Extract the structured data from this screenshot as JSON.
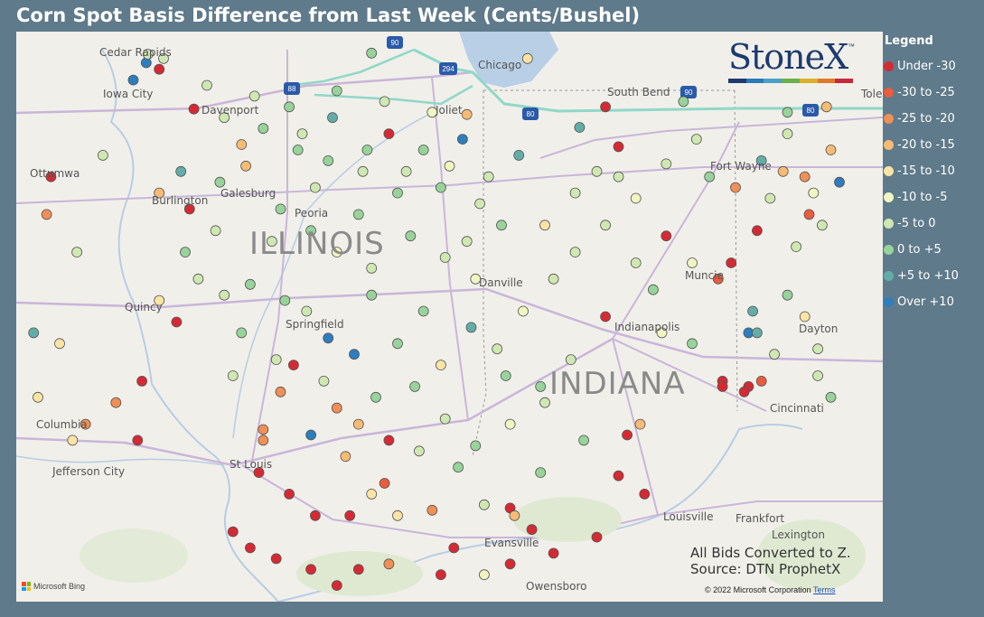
{
  "title": "Corn Spot Basis Difference from Last Week (Cents/Bushel)",
  "logo": {
    "text": "StoneX",
    "tm": "™",
    "bar_colors": [
      "#1d3b6f",
      "#2a7ab8",
      "#4aa0c9",
      "#6ab04c",
      "#d9b02a",
      "#e07a2b",
      "#c8283c"
    ]
  },
  "legend": {
    "title": "Legend",
    "items": [
      {
        "label": "Under -30",
        "color": "#d52a34"
      },
      {
        "label": "-30 to -25",
        "color": "#e95c3e"
      },
      {
        "label": "-25 to -20",
        "color": "#f08f56"
      },
      {
        "label": "-20 to -15",
        "color": "#f7bb74"
      },
      {
        "label": "-15 to -10",
        "color": "#fbe4a4"
      },
      {
        "label": "-10 to -5",
        "color": "#f1f5c2"
      },
      {
        "label": "-5 to 0",
        "color": "#cfe8b2"
      },
      {
        "label": "0 to +5",
        "color": "#97d39a"
      },
      {
        "label": "+5 to +10",
        "color": "#63ada9"
      },
      {
        "label": "Over +10",
        "color": "#2e7dbe"
      }
    ]
  },
  "map": {
    "states": [
      "ILLINOIS",
      "INDIANA"
    ],
    "cities": [
      "Cedar Rapids",
      "Iowa City",
      "Davenport",
      "Ottumwa",
      "Burlington",
      "Galesburg",
      "Peoria",
      "Quincy",
      "Springfield",
      "Columbia",
      "Jefferson City",
      "St Louis",
      "Chicago",
      "Joliet",
      "South Bend",
      "Toledo",
      "Fort Wayne",
      "Danville",
      "Muncie",
      "Indianapolis",
      "Dayton",
      "Cincinnati",
      "Louisville",
      "Frankfort",
      "Lexington",
      "Evansville",
      "Owensboro"
    ],
    "highways": [
      "90",
      "294",
      "88",
      "80",
      "90",
      "80"
    ],
    "notes": [
      "All Bids Converted to Z.",
      "Source: DTN ProphetX"
    ],
    "attribution": "Microsoft Bing",
    "copyright": "© 2022 Microsoft Corporation",
    "terms": "Terms"
  },
  "points": [
    {
      "lon": -91.5,
      "lat": 42.06,
      "cat": 9
    },
    {
      "lon": -91.48,
      "lat": 42.14,
      "cat": 6
    },
    {
      "lon": -91.35,
      "lat": 42.0,
      "cat": 0
    },
    {
      "lon": -91.3,
      "lat": 42.1,
      "cat": 6
    },
    {
      "lon": -90.95,
      "lat": 41.63,
      "cat": 0
    },
    {
      "lon": -90.6,
      "lat": 41.55,
      "cat": 6
    },
    {
      "lon": -90.15,
      "lat": 41.45,
      "cat": 7
    },
    {
      "lon": -89.7,
      "lat": 41.4,
      "cat": 6
    },
    {
      "lon": -89.3,
      "lat": 41.8,
      "cat": 7
    },
    {
      "lon": -88.9,
      "lat": 42.15,
      "cat": 7
    },
    {
      "lon": -88.2,
      "lat": 41.6,
      "cat": 5
    },
    {
      "lon": -87.8,
      "lat": 41.58,
      "cat": 3
    },
    {
      "lon": -88.7,
      "lat": 41.4,
      "cat": 0
    },
    {
      "lon": -88.95,
      "lat": 41.25,
      "cat": 7
    },
    {
      "lon": -89.4,
      "lat": 41.15,
      "cat": 7
    },
    {
      "lon": -88.5,
      "lat": 41.05,
      "cat": 6
    },
    {
      "lon": -88.1,
      "lat": 40.9,
      "cat": 7
    },
    {
      "lon": -87.65,
      "lat": 40.75,
      "cat": 6
    },
    {
      "lon": -87.2,
      "lat": 41.2,
      "cat": 8
    },
    {
      "lon": -86.5,
      "lat": 41.46,
      "cat": 8
    },
    {
      "lon": -86.05,
      "lat": 41.28,
      "cat": 0
    },
    {
      "lon": -85.5,
      "lat": 41.12,
      "cat": 6
    },
    {
      "lon": -85.0,
      "lat": 41.0,
      "cat": 7
    },
    {
      "lon": -84.4,
      "lat": 41.15,
      "cat": 8
    },
    {
      "lon": -84.1,
      "lat": 41.4,
      "cat": 6
    },
    {
      "lon": -83.9,
      "lat": 41.0,
      "cat": 2
    },
    {
      "lon": -83.6,
      "lat": 41.25,
      "cat": 3
    },
    {
      "lon": -83.5,
      "lat": 40.95,
      "cat": 9
    },
    {
      "lon": -83.85,
      "lat": 40.65,
      "cat": 1
    },
    {
      "lon": -84.0,
      "lat": 40.35,
      "cat": 6
    },
    {
      "lon": -84.45,
      "lat": 40.5,
      "cat": 0
    },
    {
      "lon": -84.75,
      "lat": 40.2,
      "cat": 0
    },
    {
      "lon": -84.9,
      "lat": 40.05,
      "cat": 1
    },
    {
      "lon": -84.5,
      "lat": 39.75,
      "cat": 8
    },
    {
      "lon": -84.55,
      "lat": 39.55,
      "cat": 9
    },
    {
      "lon": -84.25,
      "lat": 39.35,
      "cat": 6
    },
    {
      "lon": -83.75,
      "lat": 39.15,
      "cat": 6
    },
    {
      "lon": -83.6,
      "lat": 38.95,
      "cat": 7
    },
    {
      "lon": -84.4,
      "lat": 39.1,
      "cat": 1
    },
    {
      "lon": -84.55,
      "lat": 39.05,
      "cat": 0
    },
    {
      "lon": -84.85,
      "lat": 39.1,
      "cat": 0
    },
    {
      "lon": -85.8,
      "lat": 38.7,
      "cat": 3
    },
    {
      "lon": -85.95,
      "lat": 38.6,
      "cat": 0
    },
    {
      "lon": -86.05,
      "lat": 38.22,
      "cat": 0
    },
    {
      "lon": -86.45,
      "lat": 38.55,
      "cat": 7
    },
    {
      "lon": -86.9,
      "lat": 38.9,
      "cat": 6
    },
    {
      "lon": -87.3,
      "lat": 38.7,
      "cat": 5
    },
    {
      "lon": -87.7,
      "lat": 38.5,
      "cat": 7
    },
    {
      "lon": -87.9,
      "lat": 38.3,
      "cat": 7
    },
    {
      "lon": -87.6,
      "lat": 37.95,
      "cat": 6
    },
    {
      "lon": -87.3,
      "lat": 37.92,
      "cat": 0
    },
    {
      "lon": -87.25,
      "lat": 37.85,
      "cat": 3
    },
    {
      "lon": -87.05,
      "lat": 37.72,
      "cat": 0
    },
    {
      "lon": -88.2,
      "lat": 37.9,
      "cat": 2
    },
    {
      "lon": -88.6,
      "lat": 37.85,
      "cat": 4
    },
    {
      "lon": -88.9,
      "lat": 38.05,
      "cat": 4
    },
    {
      "lon": -89.15,
      "lat": 37.85,
      "cat": 0
    },
    {
      "lon": -89.55,
      "lat": 37.85,
      "cat": 0
    },
    {
      "lon": -89.85,
      "lat": 38.05,
      "cat": 0
    },
    {
      "lon": -90.2,
      "lat": 38.25,
      "cat": 0
    },
    {
      "lon": -90.15,
      "lat": 38.55,
      "cat": 2
    },
    {
      "lon": -90.15,
      "lat": 38.65,
      "cat": 2
    },
    {
      "lon": -89.6,
      "lat": 38.6,
      "cat": 9
    },
    {
      "lon": -89.3,
      "lat": 38.85,
      "cat": 2
    },
    {
      "lon": -89.05,
      "lat": 38.7,
      "cat": 3
    },
    {
      "lon": -88.7,
      "lat": 38.55,
      "cat": 0
    },
    {
      "lon": -88.75,
      "lat": 38.15,
      "cat": 1
    },
    {
      "lon": -89.95,
      "lat": 39.0,
      "cat": 2
    },
    {
      "lon": -89.4,
      "lat": 39.5,
      "cat": 9
    },
    {
      "lon": -89.1,
      "lat": 39.35,
      "cat": 9
    },
    {
      "lon": -89.65,
      "lat": 39.75,
      "cat": 6
    },
    {
      "lon": -89.9,
      "lat": 39.85,
      "cat": 7
    },
    {
      "lon": -90.3,
      "lat": 40.0,
      "cat": 7
    },
    {
      "lon": -90.6,
      "lat": 39.9,
      "cat": 6
    },
    {
      "lon": -90.9,
      "lat": 40.05,
      "cat": 6
    },
    {
      "lon": -91.15,
      "lat": 39.65,
      "cat": 0
    },
    {
      "lon": -91.35,
      "lat": 39.85,
      "cat": 4
    },
    {
      "lon": -91.05,
      "lat": 40.3,
      "cat": 7
    },
    {
      "lon": -91.35,
      "lat": 40.85,
      "cat": 3
    },
    {
      "lon": -91.1,
      "lat": 41.05,
      "cat": 8
    },
    {
      "lon": -90.65,
      "lat": 40.95,
      "cat": 7
    },
    {
      "lon": -90.35,
      "lat": 41.1,
      "cat": 3
    },
    {
      "lon": -89.95,
      "lat": 40.7,
      "cat": 7
    },
    {
      "lon": -89.6,
      "lat": 40.5,
      "cat": 7
    },
    {
      "lon": -89.3,
      "lat": 40.3,
      "cat": 5
    },
    {
      "lon": -88.9,
      "lat": 40.15,
      "cat": 6
    },
    {
      "lon": -88.45,
      "lat": 40.45,
      "cat": 7
    },
    {
      "lon": -88.05,
      "lat": 40.25,
      "cat": 6
    },
    {
      "lon": -87.7,
      "lat": 40.05,
      "cat": 5
    },
    {
      "lon": -88.3,
      "lat": 39.75,
      "cat": 7
    },
    {
      "lon": -88.6,
      "lat": 39.45,
      "cat": 7
    },
    {
      "lon": -88.1,
      "lat": 39.25,
      "cat": 4
    },
    {
      "lon": -88.4,
      "lat": 39.05,
      "cat": 7
    },
    {
      "lon": -88.85,
      "lat": 38.95,
      "cat": 7
    },
    {
      "lon": -89.45,
      "lat": 39.1,
      "cat": 6
    },
    {
      "lon": -87.45,
      "lat": 39.4,
      "cat": 6
    },
    {
      "lon": -87.15,
      "lat": 39.75,
      "cat": 5
    },
    {
      "lon": -86.8,
      "lat": 40.05,
      "cat": 6
    },
    {
      "lon": -86.55,
      "lat": 40.3,
      "cat": 6
    },
    {
      "lon": -86.2,
      "lat": 40.55,
      "cat": 6
    },
    {
      "lon": -85.85,
      "lat": 40.8,
      "cat": 5
    },
    {
      "lon": -85.5,
      "lat": 40.45,
      "cat": 0
    },
    {
      "lon": -85.2,
      "lat": 40.2,
      "cat": 5
    },
    {
      "lon": -85.65,
      "lat": 39.95,
      "cat": 7
    },
    {
      "lon": -86.2,
      "lat": 39.7,
      "cat": 0
    },
    {
      "lon": -85.55,
      "lat": 39.55,
      "cat": 5
    },
    {
      "lon": -85.2,
      "lat": 39.45,
      "cat": 7
    },
    {
      "lon": -86.6,
      "lat": 39.3,
      "cat": 6
    },
    {
      "lon": -86.95,
      "lat": 39.05,
      "cat": 7
    },
    {
      "lon": -87.35,
      "lat": 39.15,
      "cat": 7
    },
    {
      "lon": -85.85,
      "lat": 40.2,
      "cat": 6
    },
    {
      "lon": -86.05,
      "lat": 41.0,
      "cat": 6
    },
    {
      "lon": -86.55,
      "lat": 40.85,
      "cat": 6
    },
    {
      "lon": -86.9,
      "lat": 40.55,
      "cat": 4
    },
    {
      "lon": -87.4,
      "lat": 40.55,
      "cat": 7
    },
    {
      "lon": -87.85,
      "lat": 41.35,
      "cat": 9
    },
    {
      "lon": -88.6,
      "lat": 40.85,
      "cat": 7
    },
    {
      "lon": -89.05,
      "lat": 40.65,
      "cat": 7
    },
    {
      "lon": -89.75,
      "lat": 41.25,
      "cat": 7
    },
    {
      "lon": -90.4,
      "lat": 41.3,
      "cat": 3
    },
    {
      "lon": -92.0,
      "lat": 41.2,
      "cat": 6
    },
    {
      "lon": -92.6,
      "lat": 41.0,
      "cat": 0
    },
    {
      "lon": -92.3,
      "lat": 40.3,
      "cat": 6
    },
    {
      "lon": -92.8,
      "lat": 39.55,
      "cat": 8
    },
    {
      "lon": -92.5,
      "lat": 39.45,
      "cat": 4
    },
    {
      "lon": -92.65,
      "lat": 40.65,
      "cat": 2
    },
    {
      "lon": -91.55,
      "lat": 39.1,
      "cat": 0
    },
    {
      "lon": -91.85,
      "lat": 38.9,
      "cat": 2
    },
    {
      "lon": -91.6,
      "lat": 38.55,
      "cat": 0
    },
    {
      "lon": -92.2,
      "lat": 38.7,
      "cat": 2
    },
    {
      "lon": -92.35,
      "lat": 38.55,
      "cat": 4
    },
    {
      "lon": -92.75,
      "lat": 38.95,
      "cat": 4
    },
    {
      "lon": -90.5,
      "lat": 37.7,
      "cat": 0
    },
    {
      "lon": -90.3,
      "lat": 37.55,
      "cat": 0
    },
    {
      "lon": -90.0,
      "lat": 37.45,
      "cat": 0
    },
    {
      "lon": -89.6,
      "lat": 37.35,
      "cat": 0
    },
    {
      "lon": -89.3,
      "lat": 37.2,
      "cat": 0
    },
    {
      "lon": -89.05,
      "lat": 37.35,
      "cat": 0
    },
    {
      "lon": -88.7,
      "lat": 37.4,
      "cat": 2
    },
    {
      "lon": -88.1,
      "lat": 37.3,
      "cat": 0
    },
    {
      "lon": -87.6,
      "lat": 37.3,
      "cat": 5
    },
    {
      "lon": -86.8,
      "lat": 37.5,
      "cat": 0
    },
    {
      "lon": -86.3,
      "lat": 37.65,
      "cat": 0
    },
    {
      "lon": -85.75,
      "lat": 38.05,
      "cat": 0
    },
    {
      "lon": -84.85,
      "lat": 39.05,
      "cat": 0
    },
    {
      "lon": -84.6,
      "lat": 39.0,
      "cat": 0
    },
    {
      "lon": -84.45,
      "lat": 39.55,
      "cat": 8
    },
    {
      "lon": -88.0,
      "lat": 41.1,
      "cat": 5
    },
    {
      "lon": -87.55,
      "lat": 41.0,
      "cat": 6
    },
    {
      "lon": -88.3,
      "lat": 41.25,
      "cat": 7
    },
    {
      "lon": -89.0,
      "lat": 41.05,
      "cat": 6
    },
    {
      "lon": -89.55,
      "lat": 40.9,
      "cat": 6
    },
    {
      "lon": -90.05,
      "lat": 40.4,
      "cat": 6
    },
    {
      "lon": -90.7,
      "lat": 40.5,
      "cat": 6
    },
    {
      "lon": -91.0,
      "lat": 40.7,
      "cat": 0
    },
    {
      "lon": -90.0,
      "lat": 39.3,
      "cat": 6
    },
    {
      "lon": -90.4,
      "lat": 39.55,
      "cat": 7
    },
    {
      "lon": -89.8,
      "lat": 39.25,
      "cat": 0
    },
    {
      "lon": -88.05,
      "lat": 38.75,
      "cat": 6
    },
    {
      "lon": -87.75,
      "lat": 39.6,
      "cat": 8
    },
    {
      "lon": -86.3,
      "lat": 41.05,
      "cat": 6
    },
    {
      "lon": -85.15,
      "lat": 41.35,
      "cat": 6
    },
    {
      "lon": -84.7,
      "lat": 40.9,
      "cat": 2
    },
    {
      "lon": -84.3,
      "lat": 40.8,
      "cat": 6
    },
    {
      "lon": -84.15,
      "lat": 41.05,
      "cat": 3
    },
    {
      "lon": -83.8,
      "lat": 40.85,
      "cat": 5
    },
    {
      "lon": -83.7,
      "lat": 40.55,
      "cat": 6
    },
    {
      "lon": -84.1,
      "lat": 39.9,
      "cat": 7
    },
    {
      "lon": -83.9,
      "lat": 39.7,
      "cat": 4
    },
    {
      "lon": -83.75,
      "lat": 39.4,
      "cat": 6
    },
    {
      "lon": -91.65,
      "lat": 41.9,
      "cat": 9
    },
    {
      "lon": -90.8,
      "lat": 41.85,
      "cat": 6
    },
    {
      "lon": -90.25,
      "lat": 41.75,
      "cat": 6
    },
    {
      "lon": -89.85,
      "lat": 41.65,
      "cat": 7
    },
    {
      "lon": -89.35,
      "lat": 41.55,
      "cat": 8
    },
    {
      "lon": -88.75,
      "lat": 41.7,
      "cat": 6
    },
    {
      "lon": -87.1,
      "lat": 42.1,
      "cat": 4
    },
    {
      "lon": -86.2,
      "lat": 41.65,
      "cat": 0
    },
    {
      "lon": -85.3,
      "lat": 41.7,
      "cat": 7
    },
    {
      "lon": -84.1,
      "lat": 41.6,
      "cat": 7
    },
    {
      "lon": -83.65,
      "lat": 41.65,
      "cat": 3
    },
    {
      "lon": -87.8,
      "lat": 40.4,
      "cat": 6
    },
    {
      "lon": -88.9,
      "lat": 39.9,
      "cat": 7
    },
    {
      "lon": -90.5,
      "lat": 39.15,
      "cat": 6
    },
    {
      "lon": -89.2,
      "lat": 38.4,
      "cat": 3
    },
    {
      "lon": -88.35,
      "lat": 38.45,
      "cat": 6
    },
    {
      "lon": -87.95,
      "lat": 37.55,
      "cat": 0
    },
    {
      "lon": -87.3,
      "lat": 37.4,
      "cat": 0
    },
    {
      "lon": -86.95,
      "lat": 38.25,
      "cat": 7
    }
  ]
}
